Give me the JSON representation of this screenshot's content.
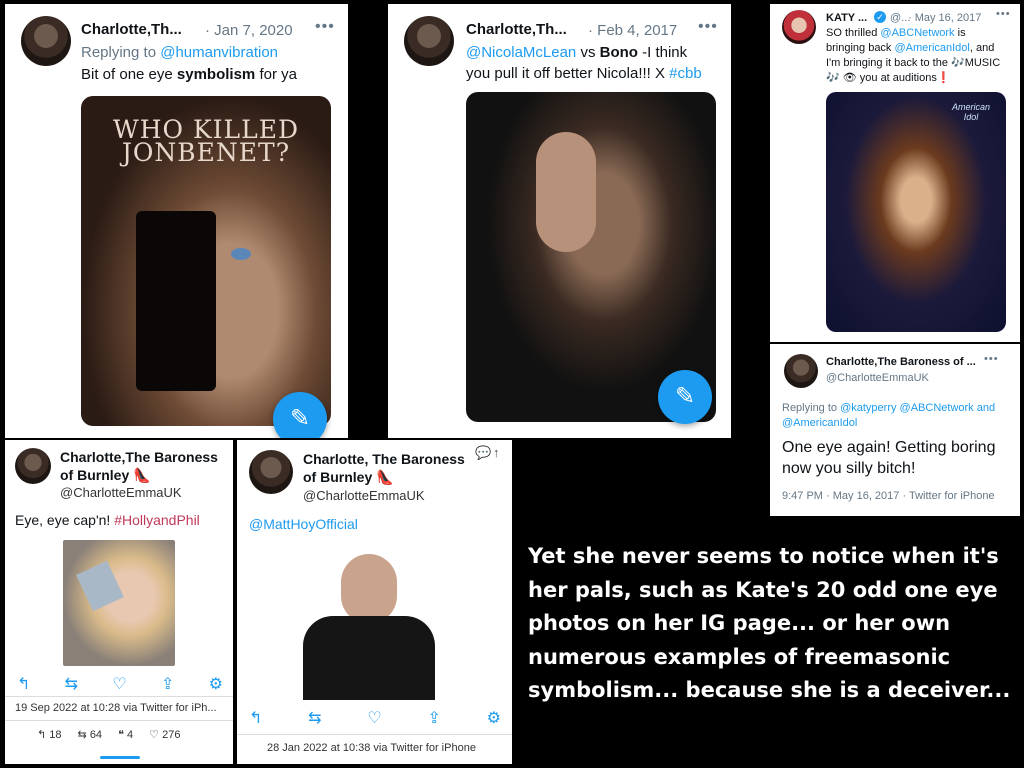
{
  "tweet1": {
    "name": "Charlotte,Th...",
    "date": "· Jan 7, 2020",
    "replying_prefix": "Replying to",
    "replying_handle": "@humanvibration",
    "text_before": "Bit of one eye ",
    "text_bold": "symbolism",
    "text_after": " for ya",
    "poster_title": "WHO KILLED JONBENET?"
  },
  "tweet2": {
    "name": "Charlotte,Th...",
    "date": "· Feb 4, 2017",
    "mention": "@NicolaMcLean",
    "vs": " vs ",
    "bold": "Bono",
    "rest1": " -I think",
    "rest2": "you pull it off better Nicola!!! X ",
    "hashtag": "#cbb"
  },
  "tweet3": {
    "name": "KATY ...",
    "handle": "@...",
    "date": "· May 16, 2017",
    "line1": "SO thrilled ",
    "mention1": "@ABCNetwork",
    "line1b": " is",
    "line2": "bringing back ",
    "mention2": "@AmericanIdol",
    "line2b": ", and",
    "line3": "I'm bringing it back to the 🎶MUSIC",
    "line4": "🎶 👁 you at auditions❗",
    "logo": "American Idol"
  },
  "tweet4": {
    "name": "Charlotte,The Baroness of ...",
    "handle": "@CharlotteEmmaUK",
    "replying_prefix": "Replying to ",
    "replying_handles": "@katyperry @ABCNetwork and",
    "replying_handles2": "@AmericanIdol",
    "text": "One eye again! Getting boring now you silly bitch!",
    "meta": "9:47 PM · May 16, 2017 · Twitter for iPhone"
  },
  "tweet5": {
    "name1": "Charlotte,The Baroness",
    "name2": "of Burnley 👠",
    "handle": "@CharlotteEmmaUK",
    "text": "Eye, eye cap'n! ",
    "hashtag": "#HollyandPhil",
    "meta": "19 Sep 2022 at 10:28 via Twitter for iPh...",
    "stats": {
      "replies": "18",
      "retweets": "64",
      "quotes": "4",
      "likes": "276"
    }
  },
  "tweet6": {
    "name1": "Charlotte, The Baroness",
    "name2": "of Burnley 👠",
    "handle": "@CharlotteEmmaUK",
    "mention": "@MattHoyOfficial",
    "meta": "28 Jan 2022 at 10:38 via Twitter for iPhone"
  },
  "caption": "Yet she never seems to notice when it's her pals, such as Kate's 20 odd one eye photos on her IG page... or her own numerous examples of freemasonic symbolism... because she is a deceiver..."
}
